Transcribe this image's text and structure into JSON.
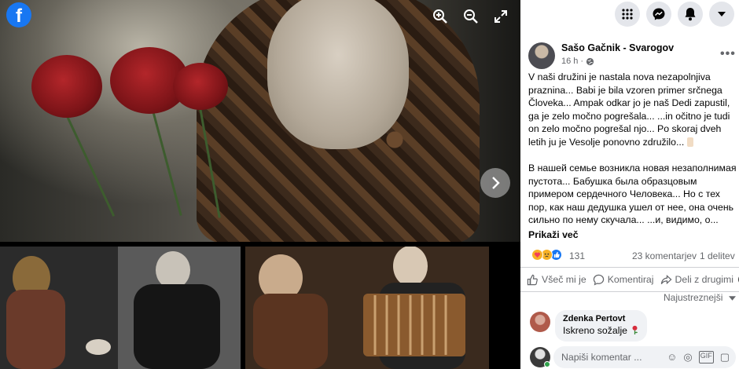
{
  "viewer": {
    "logo": "f",
    "icons": {
      "zoom_in": "zoom-in-icon",
      "zoom_out": "zoom-out-icon",
      "fullscreen": "fullscreen-icon",
      "next": "chevron-right-icon"
    }
  },
  "topbar": {
    "icons": [
      "menu-grid-icon",
      "messenger-icon",
      "notifications-bell-icon",
      "account-caret-icon"
    ]
  },
  "post": {
    "author": "Sašo Gačnik - Svarogov",
    "time": "16 h",
    "audience_icon": "globe-icon",
    "text_sl": "V naši družini je nastala nova nezapolnjiva praznina... Babi je bila vzoren primer srčnega Človeka... Ampak odkar jo je naš Dedi zapustil, ga je zelo močno pogrešala... ...in očitno je tudi on zelo močno pogrešal njo... Po skoraj dveh letih ju je Vesolje ponovno združilo...",
    "text_ru": "В нашей семье возникла новая незаполнимая пустота... Бабушка была образцовым примером сердечного Человека... Но с тех пор, как наш дедушка ушел от нее, она очень сильно по нему скучала... ...и, видимо, о...",
    "see_more": "Prikaži več"
  },
  "stats": {
    "reactions": "131",
    "comments": "23 komentarjev",
    "shares": "1 delitev",
    "reaction_colors": {
      "care": "#f7b125",
      "sad": "#f7b125",
      "like": "#1877f2"
    }
  },
  "actions": {
    "like": "Všeč mi je",
    "comment": "Komentiraj",
    "share": "Deli z drugimi"
  },
  "sort": "Najustreznejši",
  "comment": {
    "author": "Zdenka Pertovt",
    "text": "Iskreno sožalje"
  },
  "composer": {
    "placeholder": "Napiši komentar ..."
  }
}
